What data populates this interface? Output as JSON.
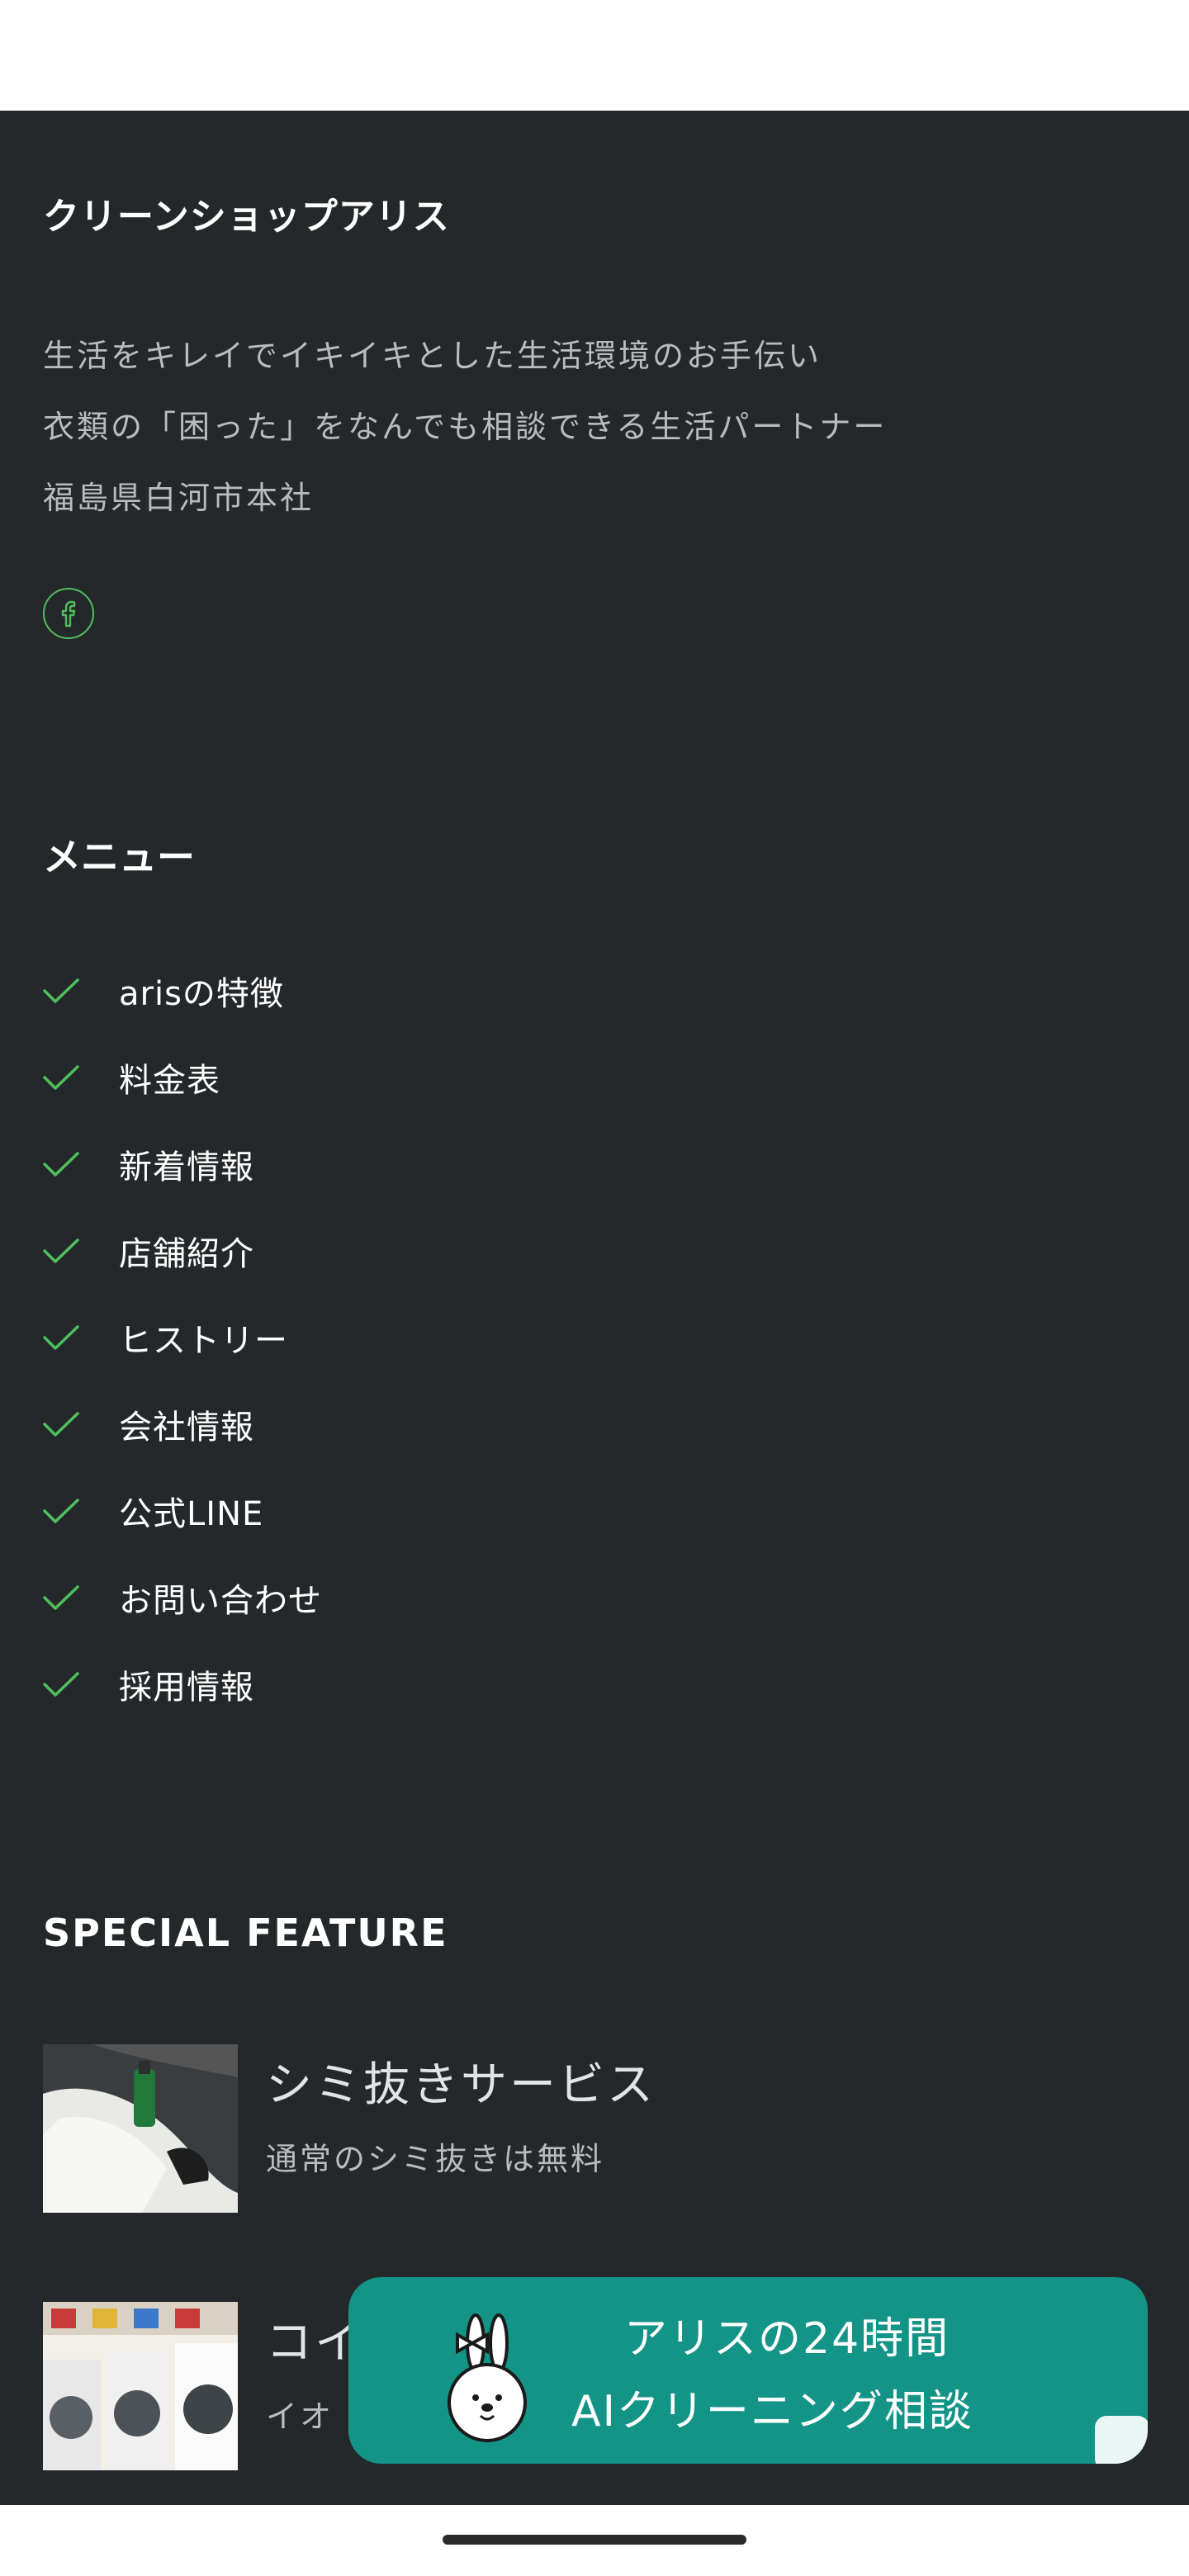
{
  "brand": {
    "name": "クリーンショップアリス"
  },
  "description": {
    "lines": [
      "生活をキレイでイキイキとした生活環境のお手伝い",
      "衣類の「困った」をなんでも相談できる生活パートナー",
      "福島県白河市本社"
    ]
  },
  "social": {
    "facebook_icon": "facebook-icon"
  },
  "menu": {
    "title": "メニュー",
    "items": [
      {
        "label": "arisの特徴"
      },
      {
        "label": "料金表"
      },
      {
        "label": "新着情報"
      },
      {
        "label": "店舗紹介"
      },
      {
        "label": "ヒストリー"
      },
      {
        "label": "会社情報"
      },
      {
        "label": "公式LINE"
      },
      {
        "label": "お問い合わせ"
      },
      {
        "label": "採用情報"
      }
    ]
  },
  "special_feature": {
    "title": "SPECIAL FEATURE",
    "items": [
      {
        "title": "シミ抜きサービス",
        "subtitle": "通常のシミ抜きは無料"
      },
      {
        "title": "コイ",
        "subtitle": "イオ"
      }
    ]
  },
  "chat_banner": {
    "line1": "アリスの24時間",
    "line2": "AIクリーニング相談"
  },
  "colors": {
    "footer_background": "#25282b",
    "accent_green": "#4fbf5c",
    "banner_teal": "#139486"
  }
}
